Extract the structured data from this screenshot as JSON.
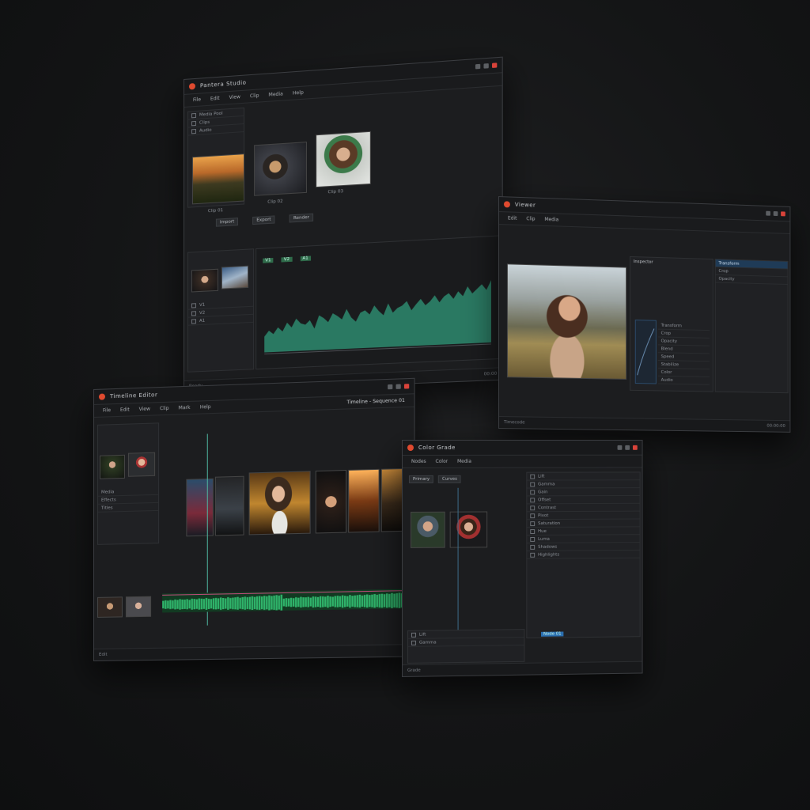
{
  "accent": "#e04a2f",
  "wave_color": "#2e8a6e",
  "track_green": "#2fb36a",
  "highlight_blue": "#2b6fb0",
  "windows": [
    {
      "title": "Pantera Studio",
      "menu": [
        "File",
        "Edit",
        "View",
        "Clip",
        "Media",
        "Help"
      ],
      "bins": [
        "Media Pool",
        "Clips",
        "Audio"
      ],
      "thumbs": [
        "Landscape",
        "Portrait",
        "Woman"
      ],
      "thumb_labels": [
        "Clip 01",
        "Clip 02",
        "Clip 03"
      ],
      "buttons": [
        "Import",
        "Export",
        "Render"
      ],
      "track_tags": [
        "V1",
        "V2",
        "A1"
      ],
      "status_left": "Ready",
      "status_right": "00:00"
    },
    {
      "title": "Viewer",
      "menu": [
        "Edit",
        "Clip",
        "Media"
      ],
      "list_header": "Inspector",
      "list_items": [
        "Transform",
        "Crop",
        "Opacity",
        "Blend",
        "Speed",
        "Stabilize",
        "Color",
        "Audio"
      ],
      "status_left": "Timecode",
      "status_right": "00:00:00"
    },
    {
      "title": "Timeline Editor",
      "menu": [
        "File",
        "Edit",
        "View",
        "Clip",
        "Mark",
        "Help"
      ],
      "toolbar_title": "Timeline - Sequence 01",
      "bins": [
        "Media",
        "Effects",
        "Titles"
      ],
      "status_left": "Edit"
    },
    {
      "title": "Color Grade",
      "menu": [
        "Nodes",
        "Color",
        "Media"
      ],
      "tabs": [
        "Primary",
        "Curves"
      ],
      "list_items": [
        "Lift",
        "Gamma",
        "Gain",
        "Offset",
        "Contrast",
        "Pivot",
        "Saturation",
        "Hue",
        "Luma",
        "Shadows",
        "Highlights"
      ],
      "selected_tag": "Node 01",
      "status_left": "Grade"
    }
  ],
  "waveform": [
    22,
    30,
    25,
    34,
    28,
    40,
    33,
    45,
    38,
    36,
    42,
    30,
    48,
    44,
    38,
    50,
    46,
    41,
    55,
    43,
    37,
    49,
    52,
    46,
    58,
    50,
    44,
    60,
    47,
    53,
    56,
    62,
    49,
    57,
    64,
    55,
    60,
    68,
    58,
    66,
    70,
    62,
    72,
    65,
    78,
    68,
    74,
    80,
    72,
    85
  ]
}
